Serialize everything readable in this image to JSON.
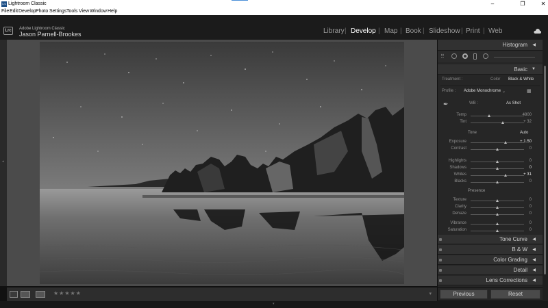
{
  "window": {
    "title": "Lightroom Classic",
    "app_icon": "Lrc",
    "minimize_icon": "minimize-icon",
    "maximize_icon": "maximize-icon",
    "close_icon": "close-icon"
  },
  "menu": [
    "File",
    "Edit",
    "Develop",
    "Photo",
    "Settings",
    "Tools",
    "View",
    "Window",
    "Help"
  ],
  "identity": {
    "badge": "Lrc",
    "app_name": "Adobe Lightroom Classic",
    "user_name": "Jason Parnell-Brookes"
  },
  "modules": {
    "items": [
      "Library",
      "Develop",
      "Map",
      "Book",
      "Slideshow",
      "Print",
      "Web"
    ],
    "active": "Develop",
    "separator": "|"
  },
  "histogram": {
    "title": "Histogram",
    "tools": [
      "grid-icon",
      "crop-icon",
      "spot-removal-icon",
      "red-eye-icon",
      "masking-icon"
    ]
  },
  "basic": {
    "title": "Basic",
    "treatment_label": "Treatment :",
    "treatment_options": [
      "Color",
      "Black & White"
    ],
    "treatment_selected": "Black & White",
    "profile_label": "Profile :",
    "profile_value": "Adobe Monochrome",
    "wb_label": "WB :",
    "wb_value": "As Shot",
    "tone_label": "Tone",
    "auto_label": "Auto",
    "presence_label": "Presence",
    "sliders": [
      {
        "name": "Temp",
        "value": "4800",
        "position": 0.34,
        "bright": false
      },
      {
        "name": "Tint",
        "value": "+ 32",
        "position": 0.6,
        "bright": false
      },
      {
        "name": "Exposure",
        "value": "+ 1.50",
        "position": 0.65,
        "bright": true
      },
      {
        "name": "Contrast",
        "value": "0",
        "position": 0.5,
        "bright": false
      },
      {
        "name": "Highlights",
        "value": "0",
        "position": 0.5,
        "bright": false
      },
      {
        "name": "Shadows",
        "value": "0",
        "position": 0.5,
        "bright": true
      },
      {
        "name": "Whites",
        "value": "+ 31",
        "position": 0.65,
        "bright": true
      },
      {
        "name": "Blacks",
        "value": "0",
        "position": 0.5,
        "bright": false
      },
      {
        "name": "Texture",
        "value": "0",
        "position": 0.5,
        "bright": false
      },
      {
        "name": "Clarity",
        "value": "0",
        "position": 0.5,
        "bright": false
      },
      {
        "name": "Dehaze",
        "value": "0",
        "position": 0.5,
        "bright": false
      },
      {
        "name": "Vibrance",
        "value": "0",
        "position": 0.5,
        "bright": false
      },
      {
        "name": "Saturation",
        "value": "0",
        "position": 0.5,
        "bright": false
      }
    ]
  },
  "panels": [
    {
      "title": "Tone Curve"
    },
    {
      "title": "B & W"
    },
    {
      "title": "Color Grading"
    },
    {
      "title": "Detail"
    },
    {
      "title": "Lens Corrections"
    }
  ],
  "footer": {
    "previous_label": "Previous",
    "reset_label": "Reset"
  },
  "toolbar": {
    "stars": "★★★★★",
    "view_icons": [
      "loupe-view-icon",
      "before-after-icon",
      "before-after-split-icon"
    ]
  },
  "colors": {
    "background": "#111111",
    "panel": "#262626",
    "panel_header": "#313131",
    "canvas": "#4b4b4b",
    "active_text": "#ffffff"
  }
}
